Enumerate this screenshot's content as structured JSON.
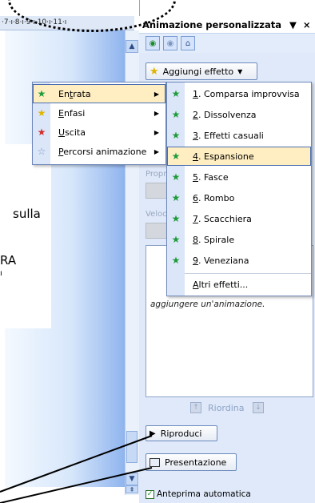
{
  "ruler": {
    "text": "·7·ı·8·ı·9·ı·10·ı·11·ı"
  },
  "slide": {
    "lines": [
      "sulla",
      "RA",
      "ı"
    ]
  },
  "task_pane": {
    "title": "Animazione personalizzata",
    "dropdown_arrow": "▼",
    "close": "×",
    "add_effect_label": "Aggiungi effetto",
    "ghost": {
      "prop": "Propr",
      "speed": "Veloc"
    },
    "hint_text": "aggiungere un'animazione.",
    "reorder_label": "Riordina",
    "play_label": "Riproduci",
    "slideshow_label": "Presentazione",
    "autopreview_label": "Anteprima automatica"
  },
  "main_menu": {
    "items": [
      {
        "label": "Entrata",
        "accel": "t",
        "pre": "En",
        "post": "rata",
        "icon": "green-star-icon",
        "highlighted": true
      },
      {
        "label": "Enfasi",
        "accel": "E",
        "pre": "",
        "post": "nfasi",
        "icon": "yellow-star-icon",
        "highlighted": false
      },
      {
        "label": "Uscita",
        "accel": "U",
        "pre": "",
        "post": "scita",
        "icon": "red-star-icon",
        "highlighted": false
      },
      {
        "label": "Percorsi animazione",
        "accel": "P",
        "pre": "",
        "post": "ercorsi animazione",
        "icon": "outline-star-icon",
        "highlighted": false
      }
    ]
  },
  "sub_menu": {
    "items": [
      {
        "num": "1",
        "text": ". Comparsa improvvisa",
        "highlighted": false
      },
      {
        "num": "2",
        "text": ". Dissolvenza",
        "highlighted": false
      },
      {
        "num": "3",
        "text": ". Effetti casuali",
        "highlighted": false
      },
      {
        "num": "4",
        "text": ". Espansione",
        "highlighted": true
      },
      {
        "num": "5",
        "text": ". Fasce",
        "highlighted": false
      },
      {
        "num": "6",
        "text": ". Rombo",
        "highlighted": false
      },
      {
        "num": "7",
        "text": ". Scacchiera",
        "highlighted": false
      },
      {
        "num": "8",
        "text": ". Spirale",
        "highlighted": false
      },
      {
        "num": "9",
        "text": ". Veneziana",
        "highlighted": false
      }
    ],
    "more": {
      "accel": "A",
      "rest": "ltri effetti..."
    }
  },
  "colors": {
    "accent": "#4a6eb0",
    "highlight": "#ffeec2",
    "pane_bg": "#dfe9f9"
  }
}
